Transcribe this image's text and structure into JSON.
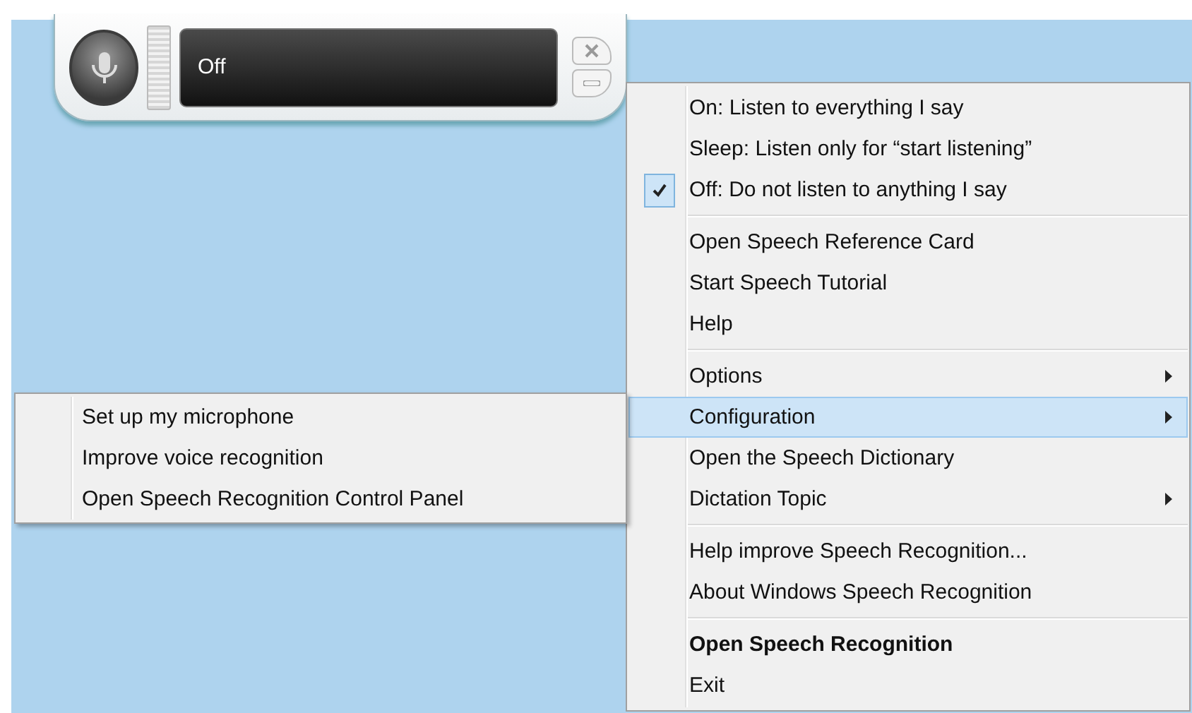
{
  "widget": {
    "status": "Off"
  },
  "menu": {
    "groups": [
      {
        "items": [
          {
            "label": "On: Listen to everything I say",
            "checked": false,
            "selected": false,
            "submenu": false,
            "default": false
          },
          {
            "label": "Sleep: Listen only for “start listening”",
            "checked": false,
            "selected": false,
            "submenu": false,
            "default": false
          },
          {
            "label": "Off: Do not listen to anything I say",
            "checked": true,
            "selected": false,
            "submenu": false,
            "default": false
          }
        ]
      },
      {
        "items": [
          {
            "label": "Open Speech Reference Card",
            "checked": false,
            "selected": false,
            "submenu": false,
            "default": false
          },
          {
            "label": "Start Speech Tutorial",
            "checked": false,
            "selected": false,
            "submenu": false,
            "default": false
          },
          {
            "label": "Help",
            "checked": false,
            "selected": false,
            "submenu": false,
            "default": false
          }
        ]
      },
      {
        "items": [
          {
            "label": "Options",
            "checked": false,
            "selected": false,
            "submenu": true,
            "default": false
          },
          {
            "label": "Configuration",
            "checked": false,
            "selected": true,
            "submenu": true,
            "default": false
          },
          {
            "label": "Open the Speech Dictionary",
            "checked": false,
            "selected": false,
            "submenu": false,
            "default": false
          },
          {
            "label": "Dictation Topic",
            "checked": false,
            "selected": false,
            "submenu": true,
            "default": false
          }
        ]
      },
      {
        "items": [
          {
            "label": "Help improve Speech Recognition...",
            "checked": false,
            "selected": false,
            "submenu": false,
            "default": false
          },
          {
            "label": "About Windows Speech Recognition",
            "checked": false,
            "selected": false,
            "submenu": false,
            "default": false
          }
        ]
      },
      {
        "items": [
          {
            "label": "Open Speech Recognition",
            "checked": false,
            "selected": false,
            "submenu": false,
            "default": true
          },
          {
            "label": "Exit",
            "checked": false,
            "selected": false,
            "submenu": false,
            "default": false
          }
        ]
      }
    ]
  },
  "submenu": {
    "items": [
      {
        "label": "Set up my microphone"
      },
      {
        "label": "Improve voice recognition"
      },
      {
        "label": "Open Speech Recognition Control Panel"
      }
    ]
  }
}
